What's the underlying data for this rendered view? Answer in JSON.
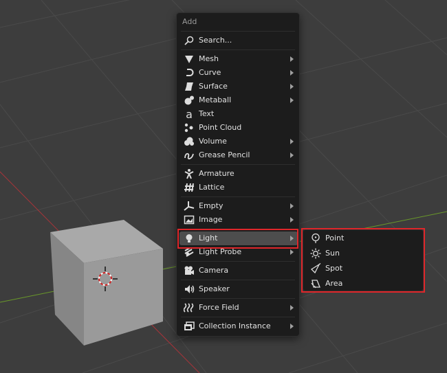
{
  "menu": {
    "title": "Add",
    "search_label": "Search...",
    "items": [
      {
        "label": "Mesh",
        "icon": "mesh-icon",
        "submenu": true
      },
      {
        "label": "Curve",
        "icon": "curve-icon",
        "submenu": true
      },
      {
        "label": "Surface",
        "icon": "surface-icon",
        "submenu": true
      },
      {
        "label": "Metaball",
        "icon": "metaball-icon",
        "submenu": true
      },
      {
        "label": "Text",
        "icon": "text-icon",
        "submenu": false
      },
      {
        "label": "Point Cloud",
        "icon": "point-cloud-icon",
        "submenu": false
      },
      {
        "label": "Volume",
        "icon": "volume-icon",
        "submenu": true
      },
      {
        "label": "Grease Pencil",
        "icon": "grease-pencil-icon",
        "submenu": true
      },
      {
        "label": "Armature",
        "icon": "armature-icon",
        "submenu": false
      },
      {
        "label": "Lattice",
        "icon": "lattice-icon",
        "submenu": false
      },
      {
        "label": "Empty",
        "icon": "empty-icon",
        "submenu": true
      },
      {
        "label": "Image",
        "icon": "image-icon",
        "submenu": true
      },
      {
        "label": "Light",
        "icon": "light-icon",
        "submenu": true
      },
      {
        "label": "Light Probe",
        "icon": "light-probe-icon",
        "submenu": true
      },
      {
        "label": "Camera",
        "icon": "camera-icon",
        "submenu": false
      },
      {
        "label": "Speaker",
        "icon": "speaker-icon",
        "submenu": false
      },
      {
        "label": "Force Field",
        "icon": "force-field-icon",
        "submenu": true
      },
      {
        "label": "Collection Instance",
        "icon": "collection-icon",
        "submenu": true
      }
    ]
  },
  "light_submenu": {
    "items": [
      {
        "label": "Point",
        "icon": "point-light-icon"
      },
      {
        "label": "Sun",
        "icon": "sun-light-icon"
      },
      {
        "label": "Spot",
        "icon": "spot-light-icon"
      },
      {
        "label": "Area",
        "icon": "area-light-icon"
      }
    ]
  },
  "colors": {
    "viewport_bg": "#3d3d3d",
    "menu_bg": "#1c1c1c",
    "active_item_bg": "#4d4d4d",
    "highlight_box": "#e0262a",
    "x_axis": "#a8343a",
    "y_axis": "#6a9a2a"
  }
}
